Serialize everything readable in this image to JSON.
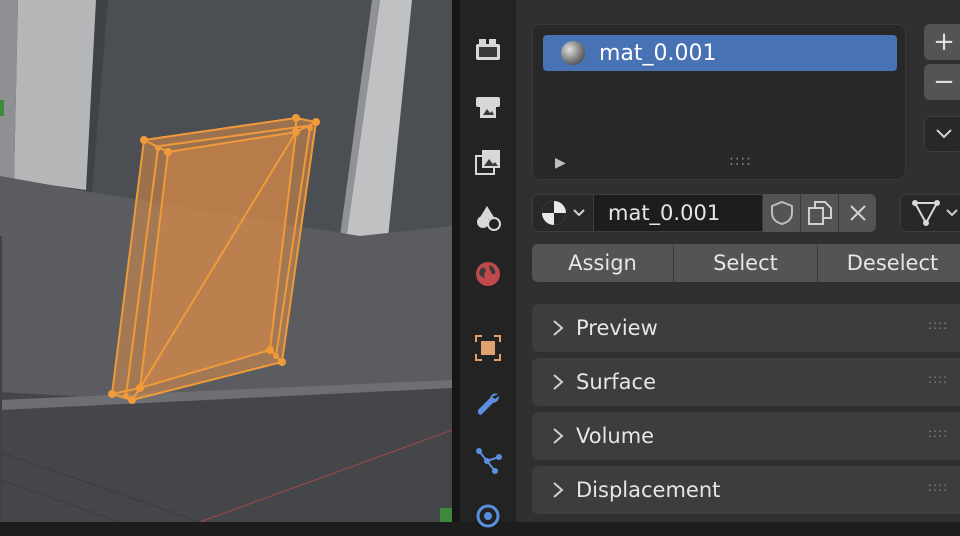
{
  "material_slots": {
    "items": [
      {
        "label": "mat_0.001",
        "selected": true
      }
    ],
    "add_label": "+",
    "remove_label": "−"
  },
  "material": {
    "name": "mat_0.001"
  },
  "actions": {
    "assign": "Assign",
    "select": "Select",
    "deselect": "Deselect"
  },
  "panels": [
    {
      "label": "Preview",
      "expanded": false
    },
    {
      "label": "Surface",
      "expanded": false
    },
    {
      "label": "Volume",
      "expanded": false
    },
    {
      "label": "Displacement",
      "expanded": false
    }
  ],
  "property_tabs": [
    {
      "icon": "render-icon",
      "active": false
    },
    {
      "icon": "output-icon",
      "active": false
    },
    {
      "icon": "view-layer-icon",
      "active": false
    },
    {
      "icon": "scene-icon",
      "active": false
    },
    {
      "icon": "world-icon",
      "active": false
    },
    {
      "icon": "object-icon",
      "active": false
    },
    {
      "icon": "modifier-wrench-icon",
      "active": false
    },
    {
      "icon": "particles-icon",
      "active": false
    },
    {
      "icon": "physics-icon",
      "active": false
    }
  ],
  "colors": {
    "selection": "#4772b3",
    "mesh_selected": "#f0963a",
    "panel_bg": "#303030",
    "viewport_bg": "#4a4d51"
  }
}
